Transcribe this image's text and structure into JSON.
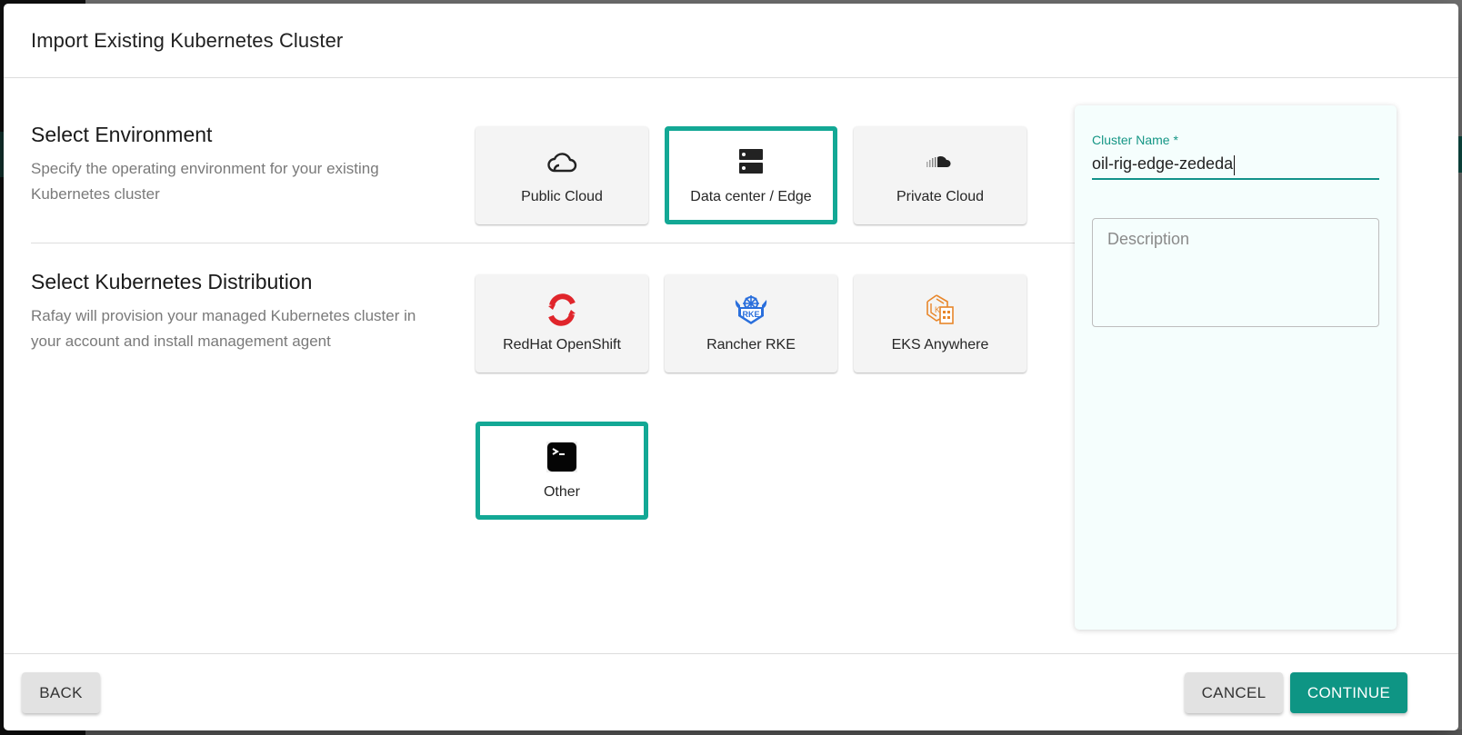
{
  "dialog": {
    "title": "Import Existing Kubernetes Cluster"
  },
  "environment": {
    "title": "Select Environment",
    "description": "Specify the operating environment for your existing Kubernetes cluster",
    "options": [
      {
        "label": "Public Cloud",
        "icon": "cloud-outline-icon",
        "selected": false
      },
      {
        "label": "Data center / Edge",
        "icon": "server-icon",
        "selected": true
      },
      {
        "label": "Private Cloud",
        "icon": "soundcloud-icon",
        "selected": false
      }
    ]
  },
  "distribution": {
    "title": "Select Kubernetes Distribution",
    "description": "Rafay will provision your managed Kubernetes cluster in your account and install management agent",
    "options": [
      {
        "label": "RedHat OpenShift",
        "icon": "openshift-icon",
        "selected": false
      },
      {
        "label": "Rancher RKE",
        "icon": "rancher-rke-icon",
        "selected": false
      },
      {
        "label": "EKS Anywhere",
        "icon": "eks-anywhere-icon",
        "selected": false
      },
      {
        "label": "Other",
        "icon": "terminal-icon",
        "selected": true
      }
    ]
  },
  "form": {
    "cluster_name_label": "Cluster Name *",
    "cluster_name_value": "oil-rig-edge-zededa",
    "description_placeholder": "Description",
    "description_value": ""
  },
  "footer": {
    "back_label": "BACK",
    "cancel_label": "CANCEL",
    "continue_label": "CONTINUE"
  },
  "colors": {
    "accent": "#13a895",
    "primary_button": "#0e9584",
    "field_label": "#159685",
    "panel_bg": "#f5fefd"
  }
}
